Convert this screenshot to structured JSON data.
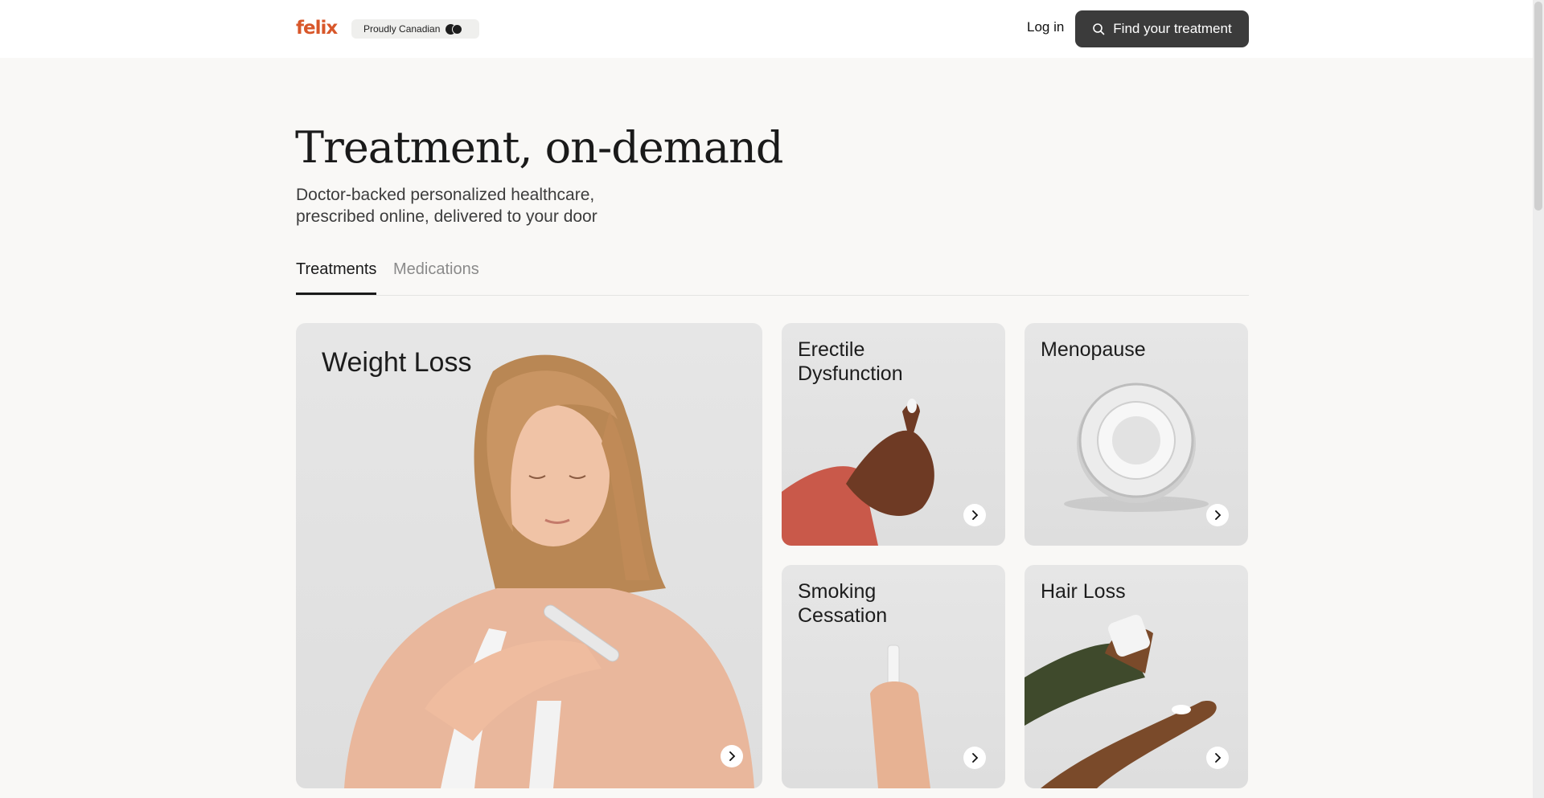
{
  "header": {
    "logo": "felix",
    "badge": "Proudly Canadian",
    "login": "Log in",
    "cta": "Find your treatment"
  },
  "hero": {
    "title": "Treatment, on-demand",
    "subtitle": "Doctor-backed personalized healthcare, prescribed online, delivered to your door"
  },
  "tabs": [
    {
      "label": "Treatments"
    },
    {
      "label": "Medications"
    }
  ],
  "cards": [
    {
      "label": "Weight Loss",
      "icon": "chevron-right-icon"
    },
    {
      "label": "Erectile Dysfunction",
      "icon": "chevron-right-icon"
    },
    {
      "label": "Menopause",
      "icon": "chevron-right-icon"
    },
    {
      "label": "Smoking Cessation",
      "icon": "chevron-right-icon"
    },
    {
      "label": "Hair Loss",
      "icon": "chevron-right-icon"
    }
  ],
  "colors": {
    "brand": "#d8572a",
    "cta_bg": "#3b3b3b",
    "page_bg": "#f9f8f6"
  }
}
